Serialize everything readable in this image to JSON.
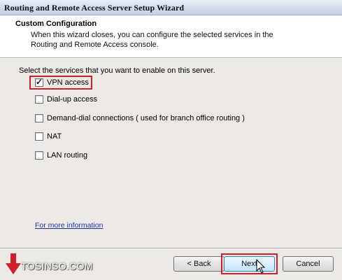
{
  "window": {
    "title": "Routing and Remote Access Server Setup Wizard"
  },
  "header": {
    "title": "Custom Configuration",
    "description": "When this wizard closes, you can configure the selected services in the Routing and Remote Access console."
  },
  "main": {
    "prompt": "Select the services that you want to enable on this server.",
    "options": [
      {
        "label": "VPN access",
        "checked": true
      },
      {
        "label": "Dial-up access",
        "checked": false
      },
      {
        "label": "Demand-dial connections ( used for branch office routing )",
        "checked": false
      },
      {
        "label": "NAT",
        "checked": false
      },
      {
        "label": "LAN routing",
        "checked": false
      }
    ],
    "more_info_link": "For more information"
  },
  "footer": {
    "back_label": "< Back",
    "next_label": "Next",
    "cancel_label": "Cancel"
  },
  "watermark": "TOSINSO.COM",
  "colors": {
    "highlight": "#d0202a",
    "link": "#1a33b8",
    "title_bar": "#cfdbea"
  }
}
